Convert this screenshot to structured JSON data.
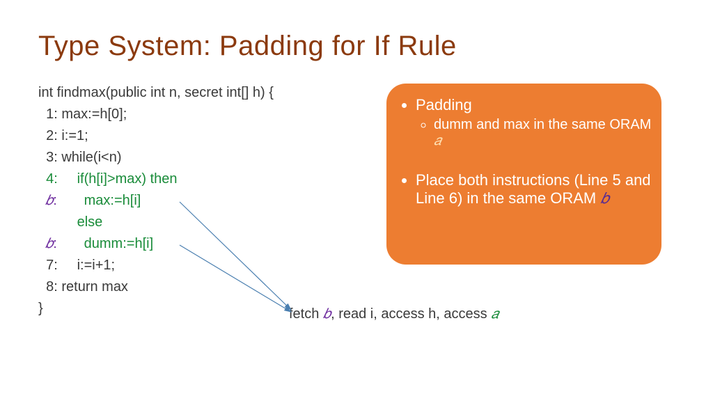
{
  "title": "Type System: Padding for If Rule",
  "code": {
    "l0": "int findmax(public int n, secret int[] h) {",
    "l1": "  1: max:=h[0];",
    "l2": "  2: i:=1;",
    "l3": "  3: while(i<n)",
    "l4_lineno": "  4:",
    "l4_body": "     if(h[i]>max) then",
    "l5_lineno": "  𝑏",
    "l5_colon": ":",
    "l5_body": "       max:=h[i]",
    "l6_else": "          else",
    "l7_lineno": "  𝑏",
    "l7_colon": ":",
    "l7_body": "       dumm:=h[i]",
    "l8": "  7:     i:=i+1;",
    "l9": "  8: return max",
    "l10": "}"
  },
  "box": {
    "b1": "Padding",
    "b1a_pre": "dumm and max in the same ORAM ",
    "b1a_var": "𝑎",
    "b2_pre": "Place both instructions (Line 5 and Line 6) in the same ORAM ",
    "b2_var": "𝑏"
  },
  "caption": {
    "c1": "fetch ",
    "c_b": "𝑏",
    "c2": ", read i, access h, access ",
    "c_a": "𝑎"
  }
}
